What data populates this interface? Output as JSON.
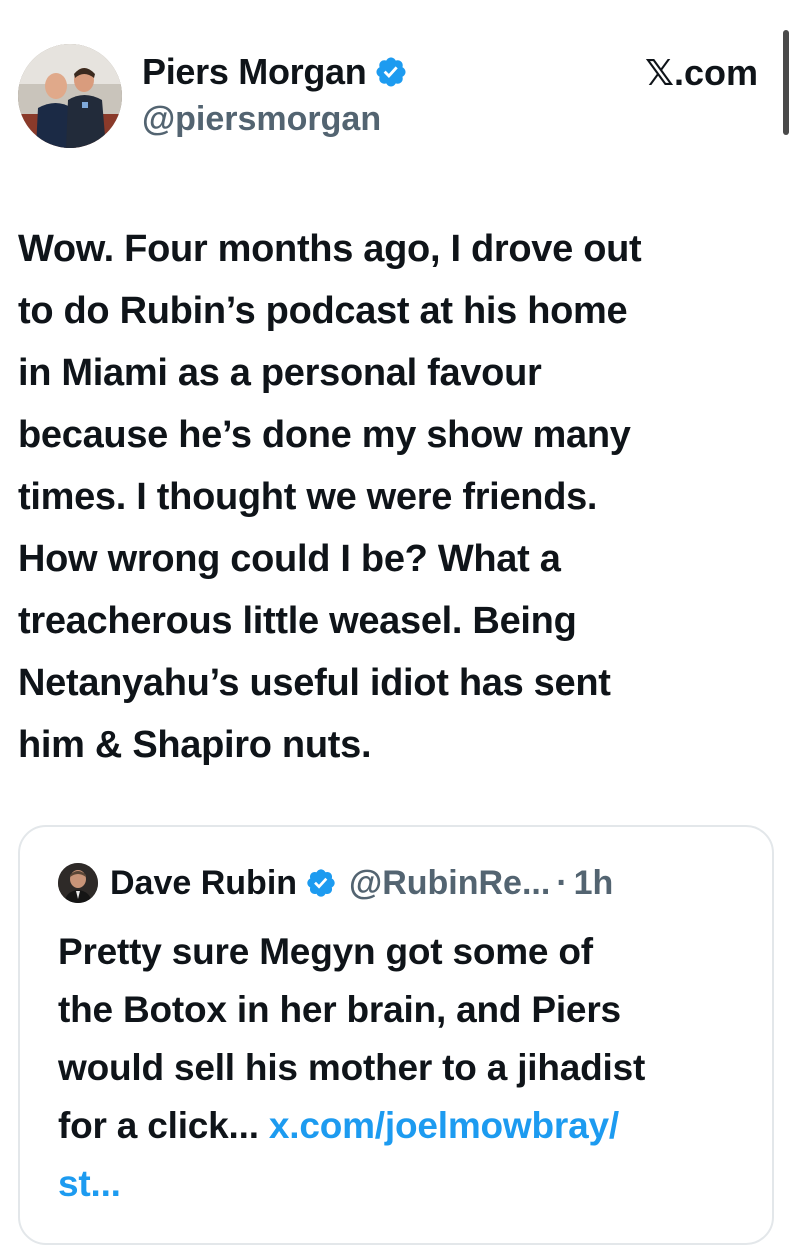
{
  "author": {
    "display_name": "Piers Morgan",
    "handle": "@piersmorgan",
    "avatar_icon": "profile-photo",
    "verified_icon": "verified-badge-icon",
    "verified_color": "#1d9bf0"
  },
  "site_label": "𝕏.com",
  "tweet": {
    "lines": [
      "Wow. Four months ago, I drove out",
      "to do Rubin’s podcast at his home",
      "in Miami as a personal favour",
      "because he’s done my show many",
      "times. I thought we were friends.",
      "How wrong could I be? What a",
      "treacherous little weasel. Being",
      "Netanyahu’s useful idiot has sent",
      "him & Shapiro nuts."
    ]
  },
  "quoted_tweet": {
    "display_name": "Dave Rubin",
    "handle": "@RubinRe...",
    "separator": "·",
    "time": "1h",
    "avatar_icon": "profile-photo",
    "verified_icon": "verified-badge-icon",
    "lines": [
      "Pretty sure Megyn got some of",
      "the Botox in her brain, and Piers",
      "would sell his mother to a jihadist"
    ],
    "last_line_text": "for a click... ",
    "link_part1": "x.com/joelmowbray/",
    "link_part2": "st..."
  },
  "colors": {
    "text": "#0f1419",
    "secondary": "#536471",
    "link": "#1d9bf0",
    "border": "#e3e7ea"
  }
}
